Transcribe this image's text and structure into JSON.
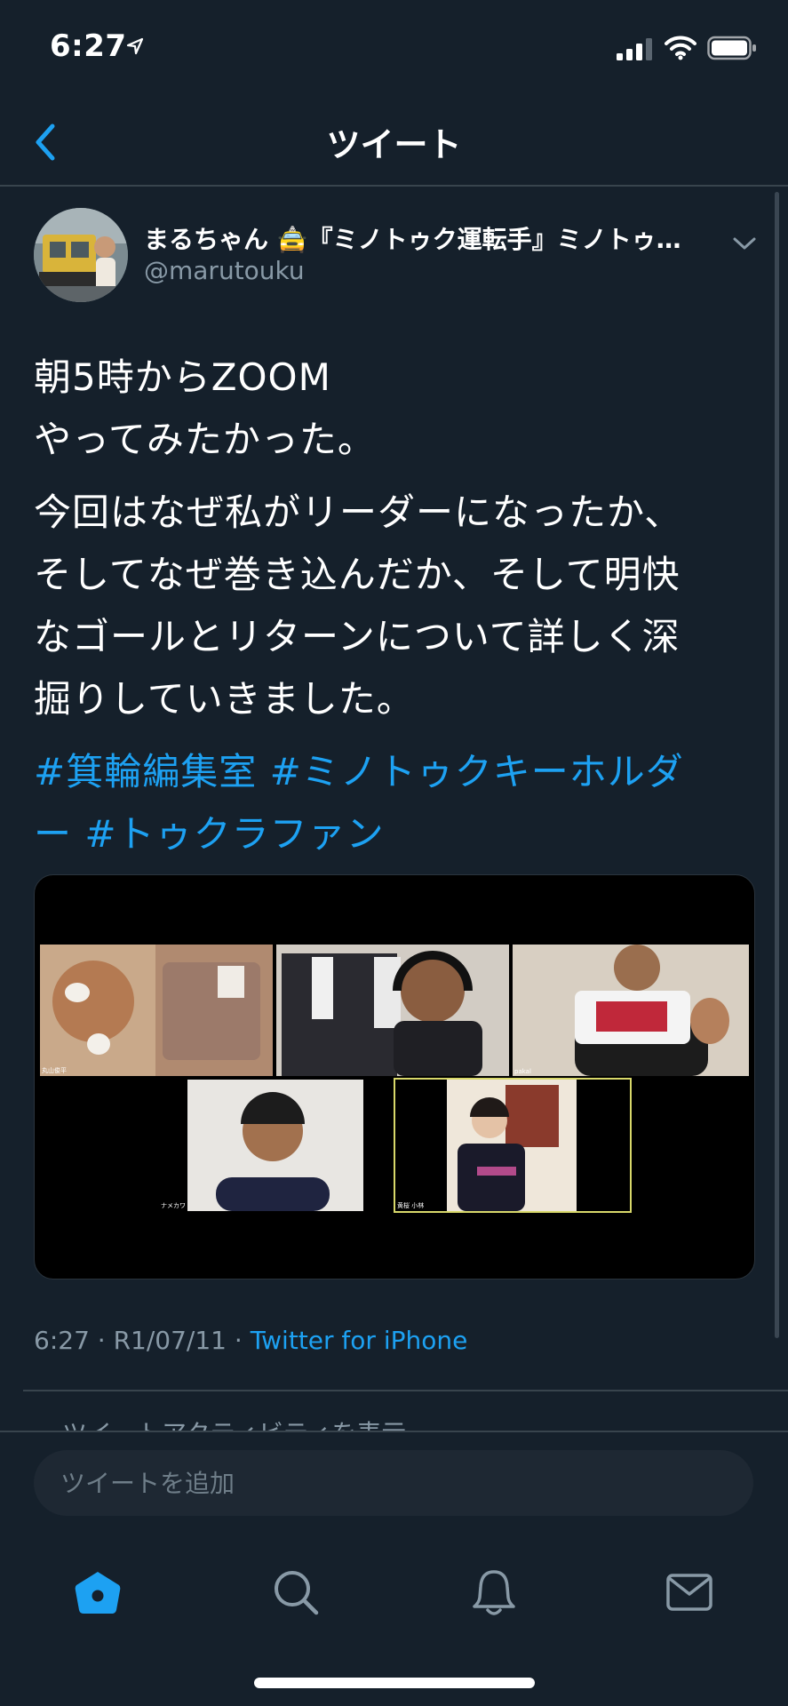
{
  "status_bar": {
    "time": "6:27"
  },
  "nav": {
    "title": "ツイート"
  },
  "tweet": {
    "author_name": "まるちゃん 🚖『ミノトゥク運転手』ミノトゥ…",
    "author_handle": "@marutouku",
    "paragraph_1": "朝5時からZOOM\nやってみたかった。",
    "paragraph_2": "今回はなぜ私がリーダーになったか、\nそしてなぜ巻き込んだか、そして明快\nなゴールとリターンについて詳しく深\n掘りしていきました。",
    "hashtags": [
      "#箕輪編集室",
      "#ミノトゥクキーホルダ\nー",
      "#トゥクラファン"
    ],
    "media": {
      "tile_labels": [
        "丸山俊平",
        "",
        "pakal",
        "ナメカワ",
        "黄桜 小林"
      ]
    },
    "timestamp": "6:27 · R1/07/11 · ",
    "source": "Twitter for iPhone",
    "activity_label": "ツイートアクティビティを表示"
  },
  "reply": {
    "placeholder": "ツイートを追加"
  },
  "tabs": [
    {
      "name": "home",
      "active": true
    },
    {
      "name": "search",
      "active": false
    },
    {
      "name": "notifications",
      "active": false
    },
    {
      "name": "messages",
      "active": false
    }
  ],
  "colors": {
    "background": "#15202b",
    "accent": "#1da1f2",
    "muted": "#8899a6",
    "divider": "#38444d"
  }
}
